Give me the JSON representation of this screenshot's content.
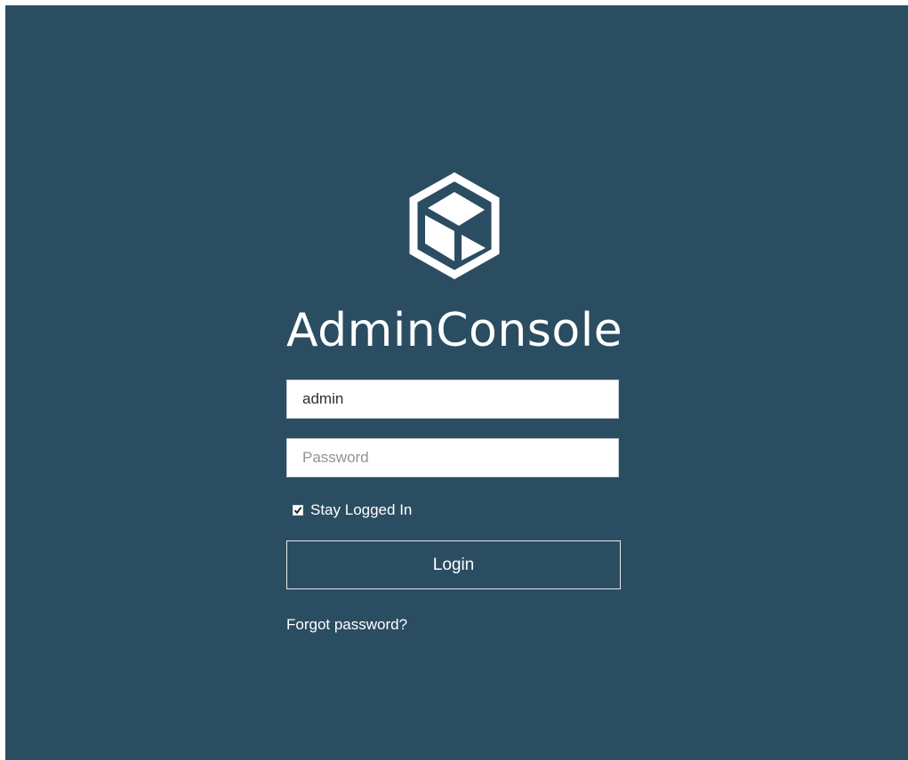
{
  "app": {
    "title": "AdminConsole",
    "logo_icon": "cube-hexagon-icon"
  },
  "colors": {
    "background": "#2b4d62",
    "text": "#ffffff"
  },
  "login_form": {
    "username_value": "admin",
    "password_placeholder": "Password",
    "stay_logged_in_label": "Stay Logged In",
    "stay_logged_in_checked": true,
    "login_button_label": "Login",
    "forgot_password_label": "Forgot password?"
  }
}
